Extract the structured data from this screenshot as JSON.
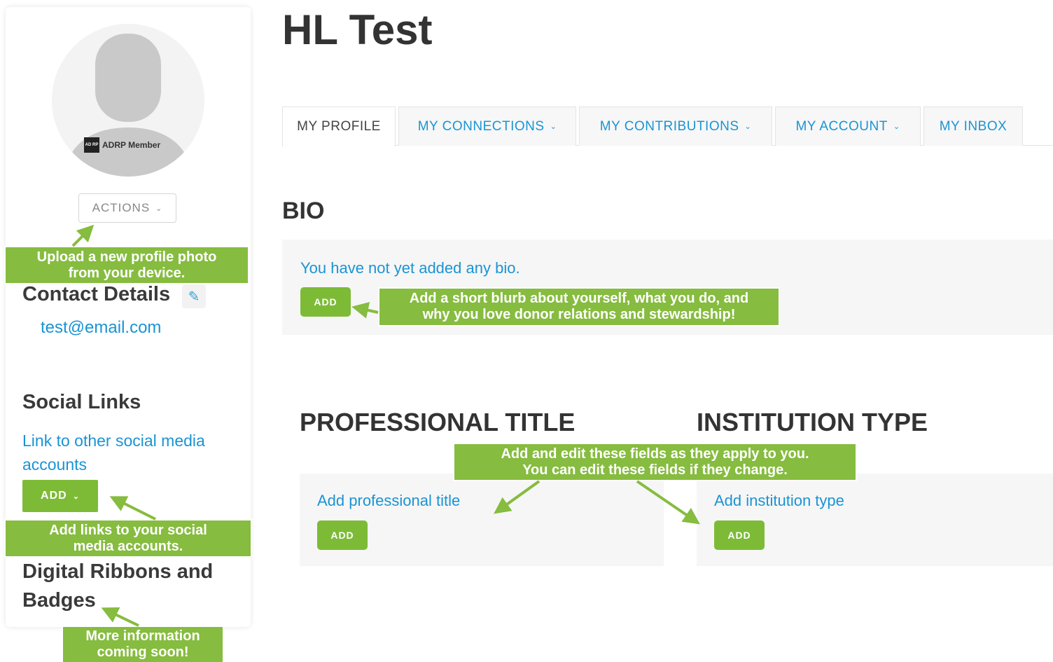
{
  "user": {
    "name": "HL Test",
    "email": "test@email.com",
    "member_badge": "ADRP Member",
    "member_logo_text": "AD RP"
  },
  "sidebar": {
    "actions_label": "ACTIONS",
    "contact_heading": "Contact Details",
    "social_heading": "Social Links",
    "social_link_text": "Link to other social media accounts",
    "social_add_label": "ADD",
    "ribbons_heading": "Digital Ribbons and Badges"
  },
  "tabs": [
    {
      "label": "MY PROFILE",
      "active": true,
      "dropdown": false
    },
    {
      "label": "MY CONNECTIONS",
      "active": false,
      "dropdown": true
    },
    {
      "label": "MY CONTRIBUTIONS",
      "active": false,
      "dropdown": true
    },
    {
      "label": "MY ACCOUNT",
      "active": false,
      "dropdown": true
    },
    {
      "label": "MY INBOX",
      "active": false,
      "dropdown": false
    }
  ],
  "bio": {
    "heading": "BIO",
    "empty_text": "You have not yet added any bio.",
    "add_label": "ADD"
  },
  "professional_title": {
    "heading": "PROFESSIONAL TITLE",
    "link_text": "Add professional title",
    "add_label": "ADD"
  },
  "institution_type": {
    "heading": "INSTITUTION TYPE",
    "link_text": "Add institution type",
    "add_label": "ADD"
  },
  "callouts": {
    "photo": [
      "Upload a new profile photo",
      "from your device."
    ],
    "bio": [
      "Add a short blurb about yourself, what you do, and",
      "why you love donor relations and stewardship!"
    ],
    "fields": [
      "Add and edit these fields as they apply to you.",
      "You can edit these fields if they change."
    ],
    "social": [
      "Add links to your social",
      "media accounts."
    ],
    "ribbons": [
      "More information",
      "coming soon!"
    ]
  },
  "colors": {
    "accent_green": "#7dbb37",
    "link_blue": "#1a94d4",
    "callout_green": "#86bc3f"
  }
}
